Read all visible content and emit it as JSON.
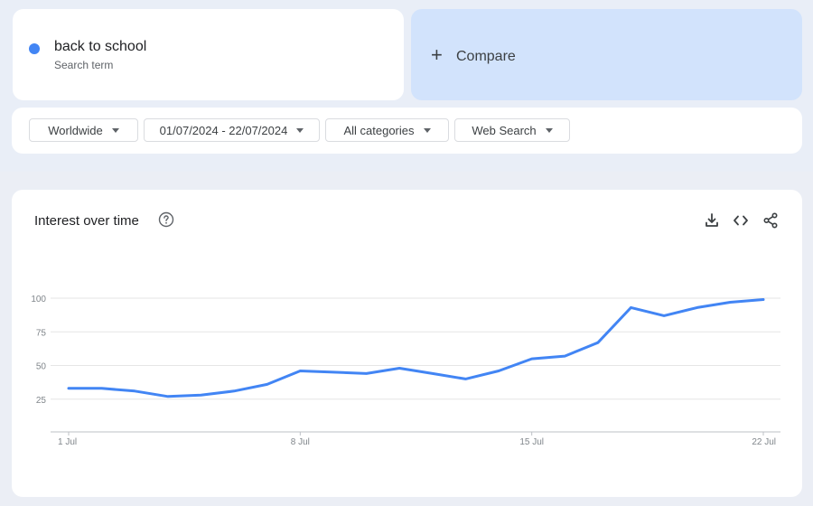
{
  "search": {
    "term": "back to school",
    "term_type": "Search term",
    "term_color": "#4285f4",
    "compare_label": "Compare",
    "compare_icon": "plus-icon"
  },
  "filters": {
    "region": "Worldwide",
    "date_range": "01/07/2024 - 22/07/2024",
    "category": "All categories",
    "property": "Web Search"
  },
  "chart_panel": {
    "title": "Interest over time",
    "help_icon": "help-icon",
    "actions": [
      "download-icon",
      "embed-code-icon",
      "share-icon"
    ]
  },
  "chart_data": {
    "type": "line",
    "title": "Interest over time",
    "xlabel": "",
    "ylabel": "",
    "x_ticks": [
      "1 Jul",
      "8 Jul",
      "15 Jul",
      "22 Jul"
    ],
    "y_ticks": [
      25,
      50,
      75,
      100
    ],
    "ylim": [
      0,
      100
    ],
    "grid": true,
    "x": [
      "2024-07-01",
      "2024-07-02",
      "2024-07-03",
      "2024-07-04",
      "2024-07-05",
      "2024-07-06",
      "2024-07-07",
      "2024-07-08",
      "2024-07-09",
      "2024-07-10",
      "2024-07-11",
      "2024-07-12",
      "2024-07-13",
      "2024-07-14",
      "2024-07-15",
      "2024-07-16",
      "2024-07-17",
      "2024-07-18",
      "2024-07-19",
      "2024-07-20",
      "2024-07-21",
      "2024-07-22"
    ],
    "series": [
      {
        "color": "#4285f4",
        "values": [
          33,
          33,
          31,
          27,
          28,
          31,
          36,
          46,
          45,
          44,
          48,
          44,
          40,
          46,
          55,
          57,
          67,
          93,
          87,
          93,
          97,
          99
        ]
      }
    ]
  }
}
